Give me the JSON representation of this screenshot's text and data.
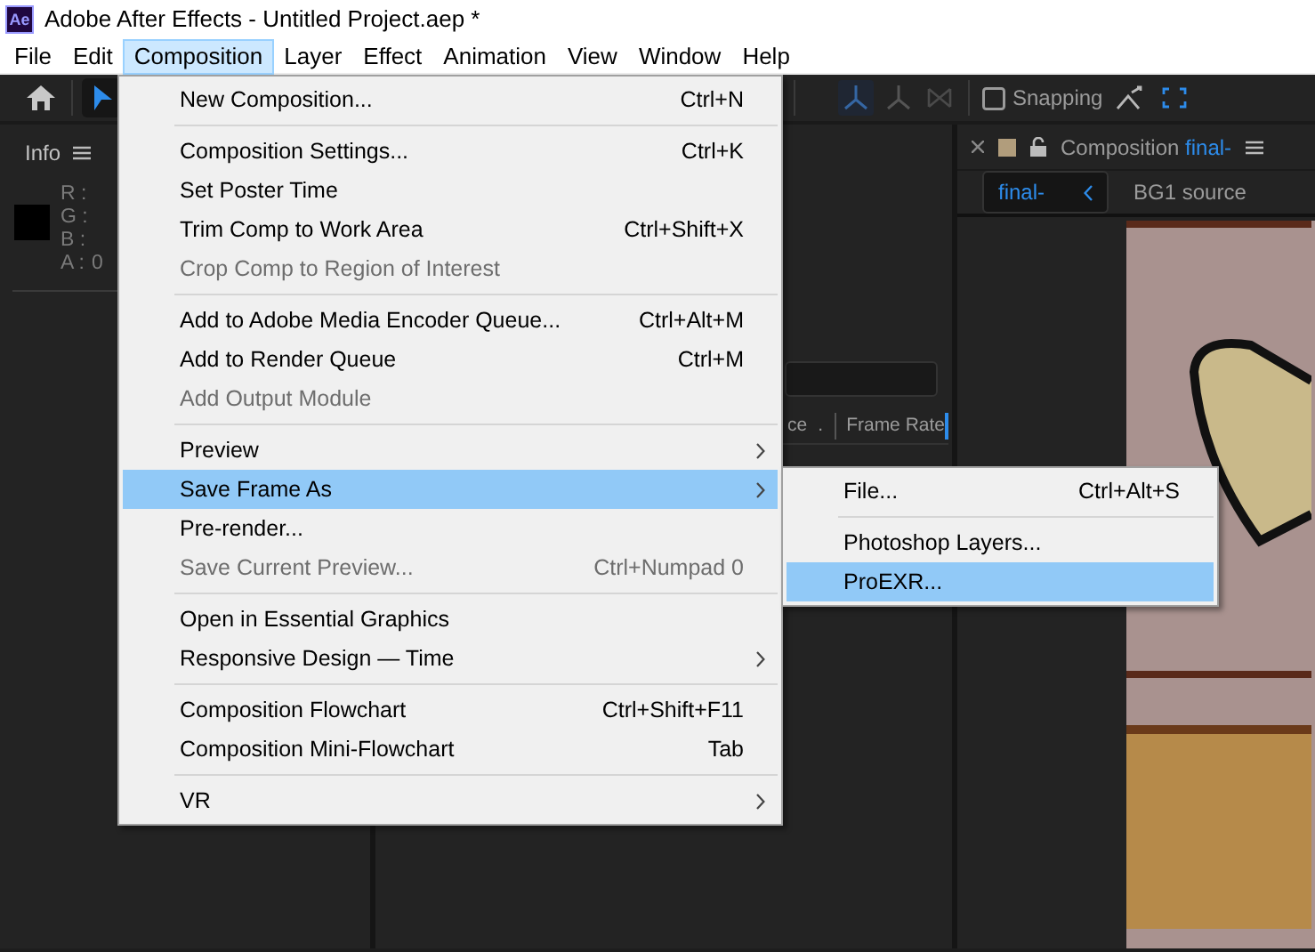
{
  "window": {
    "logo": "Ae",
    "title": "Adobe After Effects - Untitled Project.aep *"
  },
  "menu_bar": [
    {
      "label": "File",
      "selected": false
    },
    {
      "label": "Edit",
      "selected": false
    },
    {
      "label": "Composition",
      "selected": true
    },
    {
      "label": "Layer",
      "selected": false
    },
    {
      "label": "Effect",
      "selected": false
    },
    {
      "label": "Animation",
      "selected": false
    },
    {
      "label": "View",
      "selected": false
    },
    {
      "label": "Window",
      "selected": false
    },
    {
      "label": "Help",
      "selected": false
    }
  ],
  "toolbar": {
    "snapping": {
      "label": "Snapping",
      "checked": false
    }
  },
  "info_panel": {
    "title": "Info",
    "channels": [
      {
        "label": "R :"
      },
      {
        "label": "G :"
      },
      {
        "label": "B :"
      },
      {
        "label": "A :",
        "value": "0"
      }
    ]
  },
  "project_panel": {
    "columns": [
      "ce",
      ".",
      "Frame Rate"
    ]
  },
  "composition_panel": {
    "title": "Composition",
    "name": "final-",
    "breadcrumbs": [
      {
        "label": "final-",
        "selected": true
      },
      {
        "label": "BG1 source",
        "selected": false
      }
    ]
  },
  "menu": [
    {
      "kind": "item",
      "label": "New Composition...",
      "shortcut": "Ctrl+N",
      "disabled": false,
      "submenu": false,
      "selected": false
    },
    {
      "kind": "separator"
    },
    {
      "kind": "item",
      "label": "Composition Settings...",
      "shortcut": "Ctrl+K",
      "disabled": false,
      "submenu": false,
      "selected": false
    },
    {
      "kind": "item",
      "label": "Set Poster Time",
      "disabled": false,
      "submenu": false,
      "selected": false
    },
    {
      "kind": "item",
      "label": "Trim Comp to Work Area",
      "shortcut": "Ctrl+Shift+X",
      "disabled": false,
      "submenu": false,
      "selected": false
    },
    {
      "kind": "item",
      "label": "Crop Comp to Region of Interest",
      "disabled": true,
      "submenu": false,
      "selected": false
    },
    {
      "kind": "separator"
    },
    {
      "kind": "item",
      "label": "Add to Adobe Media Encoder Queue...",
      "shortcut": "Ctrl+Alt+M",
      "disabled": false,
      "submenu": false,
      "selected": false
    },
    {
      "kind": "item",
      "label": "Add to Render Queue",
      "shortcut": "Ctrl+M",
      "disabled": false,
      "submenu": false,
      "selected": false
    },
    {
      "kind": "item",
      "label": "Add Output Module",
      "disabled": true,
      "submenu": false,
      "selected": false
    },
    {
      "kind": "separator"
    },
    {
      "kind": "item",
      "label": "Preview",
      "disabled": false,
      "submenu": true,
      "selected": false
    },
    {
      "kind": "item",
      "label": "Save Frame As",
      "disabled": false,
      "submenu": true,
      "selected": true
    },
    {
      "kind": "item",
      "label": "Pre-render...",
      "disabled": false,
      "submenu": false,
      "selected": false
    },
    {
      "kind": "item",
      "label": "Save Current Preview...",
      "shortcut": "Ctrl+Numpad 0",
      "disabled": true,
      "submenu": false,
      "selected": false
    },
    {
      "kind": "separator"
    },
    {
      "kind": "item",
      "label": "Open in Essential Graphics",
      "disabled": false,
      "submenu": false,
      "selected": false
    },
    {
      "kind": "item",
      "label": "Responsive Design — Time",
      "disabled": false,
      "submenu": true,
      "selected": false
    },
    {
      "kind": "separator"
    },
    {
      "kind": "item",
      "label": "Composition Flowchart",
      "shortcut": "Ctrl+Shift+F11",
      "disabled": false,
      "submenu": false,
      "selected": false
    },
    {
      "kind": "item",
      "label": "Composition Mini-Flowchart",
      "shortcut": "Tab",
      "disabled": false,
      "submenu": false,
      "selected": false
    },
    {
      "kind": "separator"
    },
    {
      "kind": "item",
      "label": "VR",
      "disabled": false,
      "submenu": true,
      "selected": false
    }
  ],
  "submenu": [
    {
      "kind": "item",
      "label": "File...",
      "shortcut": "Ctrl+Alt+S",
      "disabled": false,
      "submenu": false,
      "selected": false
    },
    {
      "kind": "separator"
    },
    {
      "kind": "item",
      "label": "Photoshop Layers...",
      "disabled": false,
      "submenu": false,
      "selected": false
    },
    {
      "kind": "item",
      "label": "ProEXR...",
      "disabled": false,
      "submenu": false,
      "selected": true
    }
  ]
}
